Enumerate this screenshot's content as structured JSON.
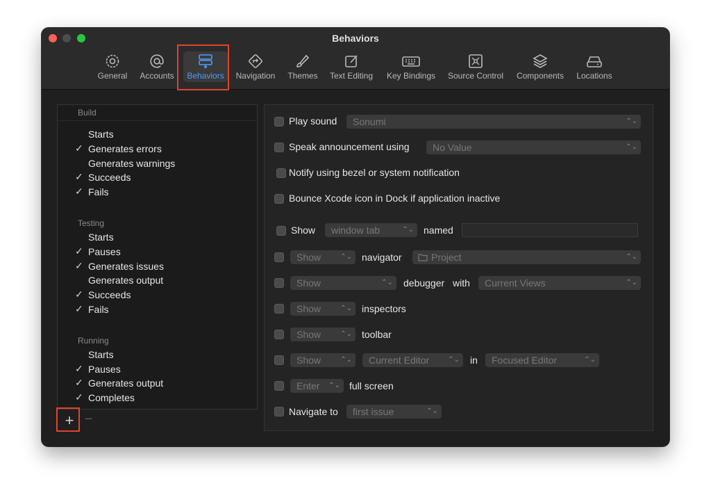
{
  "window": {
    "title": "Behaviors"
  },
  "toolbar": {
    "tabs": [
      {
        "label": "General",
        "icon": "gear-icon"
      },
      {
        "label": "Accounts",
        "icon": "at-icon"
      },
      {
        "label": "Behaviors",
        "icon": "behaviors-icon"
      },
      {
        "label": "Navigation",
        "icon": "navigation-icon"
      },
      {
        "label": "Themes",
        "icon": "brush-icon"
      },
      {
        "label": "Text Editing",
        "icon": "text-editing-icon"
      },
      {
        "label": "Key Bindings",
        "icon": "keyboard-icon"
      },
      {
        "label": "Source Control",
        "icon": "source-control-icon"
      },
      {
        "label": "Components",
        "icon": "layers-icon"
      },
      {
        "label": "Locations",
        "icon": "drive-icon"
      }
    ],
    "selected": "Behaviors",
    "accent": "#4e9bff",
    "highlight_color": "#e0442c"
  },
  "sidebar": {
    "sections": [
      {
        "title": "Build",
        "items": [
          {
            "label": "Starts",
            "checked": false
          },
          {
            "label": "Generates errors",
            "checked": true
          },
          {
            "label": "Generates warnings",
            "checked": false
          },
          {
            "label": "Succeeds",
            "checked": true
          },
          {
            "label": "Fails",
            "checked": true
          }
        ]
      },
      {
        "title": "Testing",
        "items": [
          {
            "label": "Starts",
            "checked": false
          },
          {
            "label": "Pauses",
            "checked": true
          },
          {
            "label": "Generates issues",
            "checked": true
          },
          {
            "label": "Generates output",
            "checked": false
          },
          {
            "label": "Succeeds",
            "checked": true
          },
          {
            "label": "Fails",
            "checked": true
          }
        ]
      },
      {
        "title": "Running",
        "items": [
          {
            "label": "Starts",
            "checked": false
          },
          {
            "label": "Pauses",
            "checked": true
          },
          {
            "label": "Generates output",
            "checked": true
          },
          {
            "label": "Completes",
            "checked": true
          }
        ]
      }
    ],
    "add_label": "+",
    "remove_label": "−",
    "check_mark": "✓"
  },
  "main": {
    "play_sound": {
      "label": "Play sound",
      "select": "Sonumi"
    },
    "speak": {
      "label": "Speak announcement using",
      "select": "No Value"
    },
    "notify": {
      "label": "Notify using bezel or system notification"
    },
    "bounce": {
      "label": "Bounce Xcode icon in Dock if application inactive"
    },
    "show_tab": {
      "label": "Show",
      "select": "window tab",
      "named": "named",
      "name_value": ""
    },
    "navigator": {
      "select": "Show",
      "label": "navigator",
      "select2": "Project"
    },
    "debugger": {
      "select": "Show",
      "label": "debugger",
      "with": "with",
      "select2": "Current Views"
    },
    "inspectors": {
      "select": "Show",
      "label": "inspectors"
    },
    "toolbar_row": {
      "select": "Show",
      "label": "toolbar"
    },
    "editor": {
      "select": "Show",
      "select2": "Current Editor",
      "in": "in",
      "select3": "Focused Editor"
    },
    "fullscreen": {
      "select": "Enter",
      "label": "full screen"
    },
    "navigate": {
      "label": "Navigate to",
      "select": "first issue"
    },
    "chevron": "⌃⌄"
  }
}
